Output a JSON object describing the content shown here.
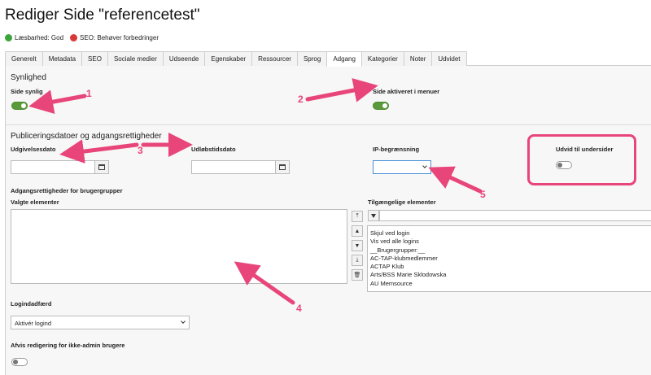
{
  "header": {
    "title": "Rediger Side \"referencetest\"",
    "readability": "Læsbarhed: God",
    "seo": "SEO: Behøver forbedringer"
  },
  "tabs": [
    {
      "label": "Generelt"
    },
    {
      "label": "Metadata"
    },
    {
      "label": "SEO"
    },
    {
      "label": "Sociale medier"
    },
    {
      "label": "Udseende"
    },
    {
      "label": "Egenskaber"
    },
    {
      "label": "Ressourcer"
    },
    {
      "label": "Sprog"
    },
    {
      "label": "Adgang",
      "active": true
    },
    {
      "label": "Kategorier"
    },
    {
      "label": "Noter"
    },
    {
      "label": "Udvidet"
    }
  ],
  "visibility": {
    "section_title": "Synlighed",
    "page_visible_label": "Side synlig",
    "page_visible_on": true,
    "menu_enabled_label": "Side aktiveret i menuer",
    "menu_enabled_on": true
  },
  "publish": {
    "section_title": "Publiceringsdatoer og adgangsrettigheder",
    "start_label": "Udgivelsesdato",
    "start_value": "",
    "end_label": "Udløbstidsdato",
    "end_value": "",
    "ip_label": "IP-begrænsning",
    "ip_value": "",
    "extend_label": "Udvid til undersider",
    "extend_on": false
  },
  "groups": {
    "section_label": "Adgangsrettigheder for brugergrupper",
    "selected_label": "Valgte elementer",
    "available_label": "Tilgængelige elementer",
    "available_items": [
      "Skjul ved login",
      "Vis ved alle logins",
      "__Brugergrupper:__",
      "AC-TAP-klubmedlemmer",
      "ACTAP Klub",
      "Arts/BSS Marie Sklodowska",
      "AU Memsource"
    ]
  },
  "login": {
    "label": "Logindadfærd",
    "value": "Aktivér logind"
  },
  "reject": {
    "label": "Afvis redigering for ikke-admin brugere",
    "on": false
  },
  "annotations": [
    "1",
    "2",
    "3",
    "4",
    "5"
  ],
  "colors": {
    "accent": "#e8457a",
    "toggle_on": "#5a9a3b",
    "good": "#3aa53a",
    "bad": "#d93838"
  }
}
